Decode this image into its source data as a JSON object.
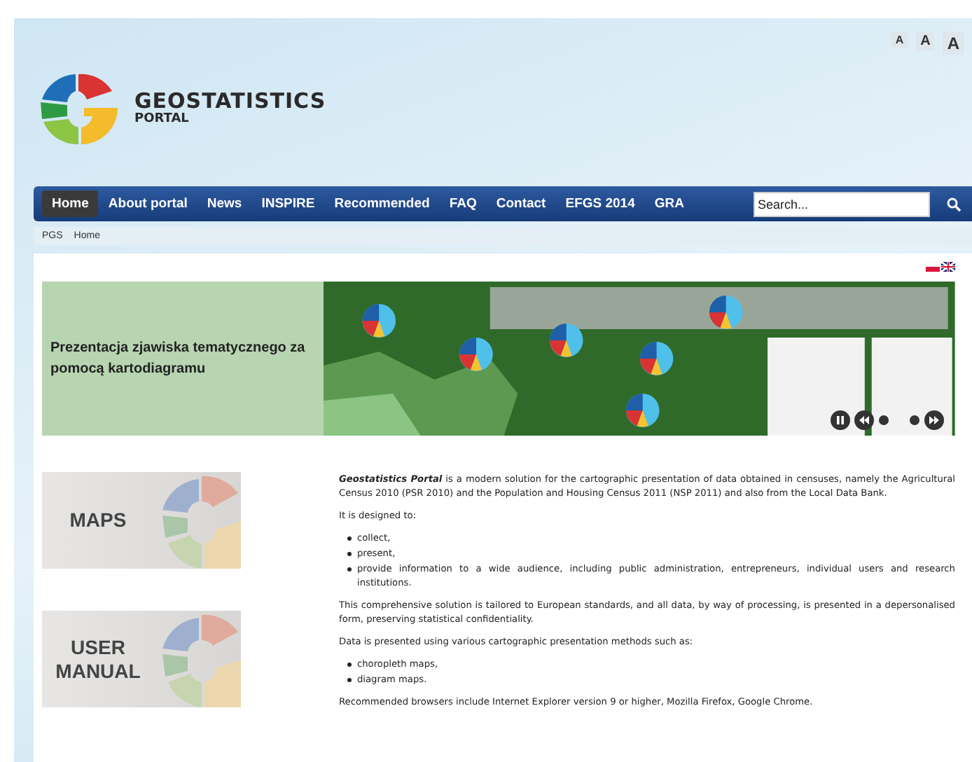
{
  "header": {
    "logo_title": "GEOSTATISTICS",
    "logo_subtitle": "PORTAL",
    "font_sizes": [
      "A",
      "A",
      "A"
    ]
  },
  "nav": {
    "items": [
      {
        "label": "Home",
        "selected": true
      },
      {
        "label": "About portal",
        "selected": false
      },
      {
        "label": "News",
        "selected": false
      },
      {
        "label": "INSPIRE",
        "selected": false
      },
      {
        "label": "Recommended",
        "selected": false
      },
      {
        "label": "FAQ",
        "selected": false
      },
      {
        "label": "Contact",
        "selected": false
      },
      {
        "label": "EFGS 2014",
        "selected": false
      },
      {
        "label": "GRA",
        "selected": false
      }
    ],
    "search": {
      "placeholder": "Search..."
    }
  },
  "breadcrumb": [
    "PGS",
    "Home"
  ],
  "banner": {
    "caption": "Prezentacja zjawiska tematycznego za pomocą kartodiagramu"
  },
  "tiles": [
    {
      "label": "MAPS"
    },
    {
      "label": "USER MANUAL"
    }
  ],
  "content": {
    "intro": "**Geostatistics Portal** is a modern solution for the cartographic presentation of data obtained in censuses, namely the Agricultural Census 2010 (PSR 2010) and the Population and Housing Census 2011 (NSP 2011) and also from the Local Data Bank.",
    "designed_heading": "It is designed to:",
    "designed_items": [
      "collect,",
      "present,",
      "provide information to a wide audience, including public administration, entrepreneurs, individual users and research institutions."
    ],
    "standards": "This comprehensive solution is tailored to European standards, and all data, by way of processing, is presented in a depersonalised form, preserving statistical confidentiality.",
    "methods_heading": "Data is presented using various cartographic presentation methods such as:",
    "methods_items": [
      "choropleth maps,",
      "diagram maps."
    ],
    "browsers": "Recommended browsers include Internet Explorer version 9 or higher, Mozilla Firefox, Google Chrome."
  }
}
